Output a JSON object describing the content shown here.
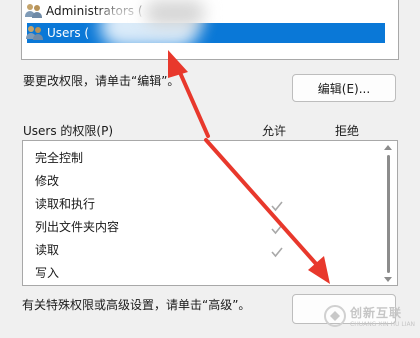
{
  "groups": [
    {
      "name": "Administrators ("
    },
    {
      "name": "Users ("
    }
  ],
  "edit_hint": "要更改权限，请单击“编辑”。",
  "edit_button": "编辑(E)...",
  "perm_header": {
    "title": "Users 的权限(P)",
    "allow": "允许",
    "deny": "拒绝"
  },
  "permissions": [
    {
      "label": "完全控制",
      "allow": false
    },
    {
      "label": "修改",
      "allow": false
    },
    {
      "label": "读取和执行",
      "allow": true
    },
    {
      "label": "列出文件夹内容",
      "allow": true
    },
    {
      "label": "读取",
      "allow": true
    },
    {
      "label": "写入",
      "allow": false
    }
  ],
  "advanced_hint": "有关特殊权限或高级设置，请单击“高级”。",
  "watermark": {
    "text": "创新互联",
    "sub": "CHUANG XIN HU LIAN"
  },
  "colors": {
    "selection": "#0a78d7",
    "arrow": "#e8382c",
    "check": "#a8a8a8"
  }
}
